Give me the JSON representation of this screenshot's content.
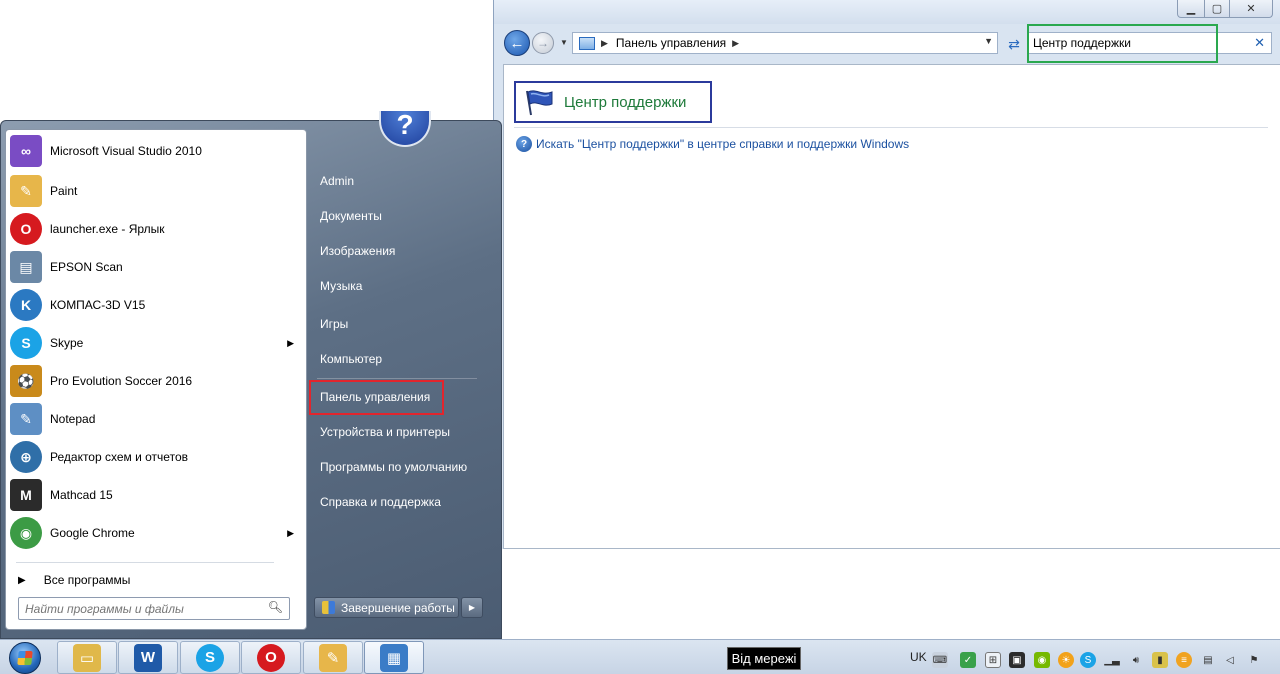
{
  "control_panel": {
    "address_path": "Панель управления",
    "search_value": "Центр поддержки",
    "window_buttons": {
      "minimize": "▁",
      "maximize": "▢",
      "close": "✕"
    },
    "result_title": "Центр поддержки",
    "help_link": "Искать \"Центр поддержки\" в центре справки и поддержки Windows"
  },
  "start_menu": {
    "programs": [
      {
        "label": "Microsoft Visual Studio 2010",
        "icon": "visual-studio-icon",
        "color": "#7a4cc4",
        "glyph": "∞",
        "submenu": false
      },
      {
        "label": "Paint",
        "icon": "paint-icon",
        "color": "#e7b64a",
        "glyph": "✎",
        "submenu": false
      },
      {
        "label": "launcher.exe - Ярлык",
        "icon": "opera-icon",
        "color": "#d61a1f",
        "glyph": "O",
        "submenu": false
      },
      {
        "label": "EPSON Scan",
        "icon": "scanner-icon",
        "color": "#6b88a6",
        "glyph": "▤",
        "submenu": false
      },
      {
        "label": "КОМПАС-3D V15",
        "icon": "kompas-icon",
        "color": "#2b79c2",
        "glyph": "K",
        "submenu": false
      },
      {
        "label": "Skype",
        "icon": "skype-icon",
        "color": "#1ba3e6",
        "glyph": "S",
        "submenu": true
      },
      {
        "label": "Pro Evolution Soccer 2016",
        "icon": "pes-icon",
        "color": "#c98a1b",
        "glyph": "⚽",
        "submenu": false
      },
      {
        "label": "Notepad",
        "icon": "notepad-icon",
        "color": "#5e8fc4",
        "glyph": "✎",
        "submenu": false
      },
      {
        "label": "Редактор схем и отчетов",
        "icon": "schema-editor-icon",
        "color": "#2f6fa8",
        "glyph": "⊕",
        "submenu": false
      },
      {
        "label": "Mathcad 15",
        "icon": "mathcad-icon",
        "color": "#2b2b2b",
        "glyph": "M",
        "submenu": false
      },
      {
        "label": "Google Chrome",
        "icon": "chrome-icon",
        "color": "#3c9b45",
        "glyph": "◉",
        "submenu": true
      }
    ],
    "all_programs": "Все программы",
    "search_placeholder": "Найти программы и файлы",
    "places": [
      "Admin",
      "Документы",
      "Изображения",
      "Музыка",
      "Игры",
      "Компьютер",
      "Панель управления",
      "Устройства и принтеры",
      "Программы по умолчанию",
      "Справка и поддержка"
    ],
    "shutdown": "Завершение работы"
  },
  "taskbar": {
    "pinned": [
      {
        "name": "explorer-icon",
        "color": "#e0b84a",
        "glyph": "▭"
      },
      {
        "name": "word-icon",
        "color": "#1f5aa8",
        "glyph": "W"
      },
      {
        "name": "skype-icon",
        "color": "#1ba3e6",
        "glyph": "S"
      },
      {
        "name": "opera-icon",
        "color": "#d61a1f",
        "glyph": "O"
      },
      {
        "name": "paint-icon",
        "color": "#e7b64a",
        "glyph": "✎"
      },
      {
        "name": "control-panel-icon",
        "color": "#3a7cc7",
        "glyph": "▦"
      }
    ],
    "tooltip": "Від мережі",
    "language": "UK"
  }
}
